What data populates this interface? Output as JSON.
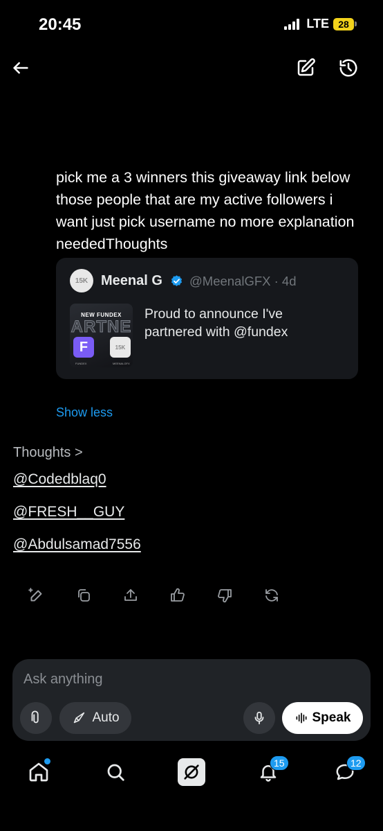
{
  "status_bar": {
    "time": "20:45",
    "network": "LTE",
    "battery": "28"
  },
  "prompt": {
    "text": "pick me a 3 winners this giveaway link below those people that are my active followers i want just pick username no more explanation neededThoughts"
  },
  "quote": {
    "avatar_text": "15K",
    "name": "Meenal G",
    "handle_time": "@MeenalGFX · 4d",
    "media": {
      "top_text": "NEW FUNDEX",
      "big_text": "ARTNE",
      "logo_letter": "F",
      "badge_text": "15K",
      "foot_left": "FUNDEX",
      "foot_right": "MEENALGFX"
    },
    "text": "Proud to announce I've partnered with @fundex"
  },
  "show_less": "Show less",
  "thoughts_label": "Thoughts >",
  "answers": [
    "@Codedblaq0",
    "@FRESH__GUY",
    "@Abdulsamad7556"
  ],
  "composer": {
    "placeholder": "Ask anything",
    "auto_label": "Auto",
    "speak_label": "Speak"
  },
  "bottom_nav": {
    "notifications_count": "15",
    "messages_count": "12"
  },
  "colors": {
    "accent": "#1d9bf0",
    "background": "#000000",
    "card": "#16181c",
    "composer": "#202327",
    "battery": "#f2d21b"
  }
}
